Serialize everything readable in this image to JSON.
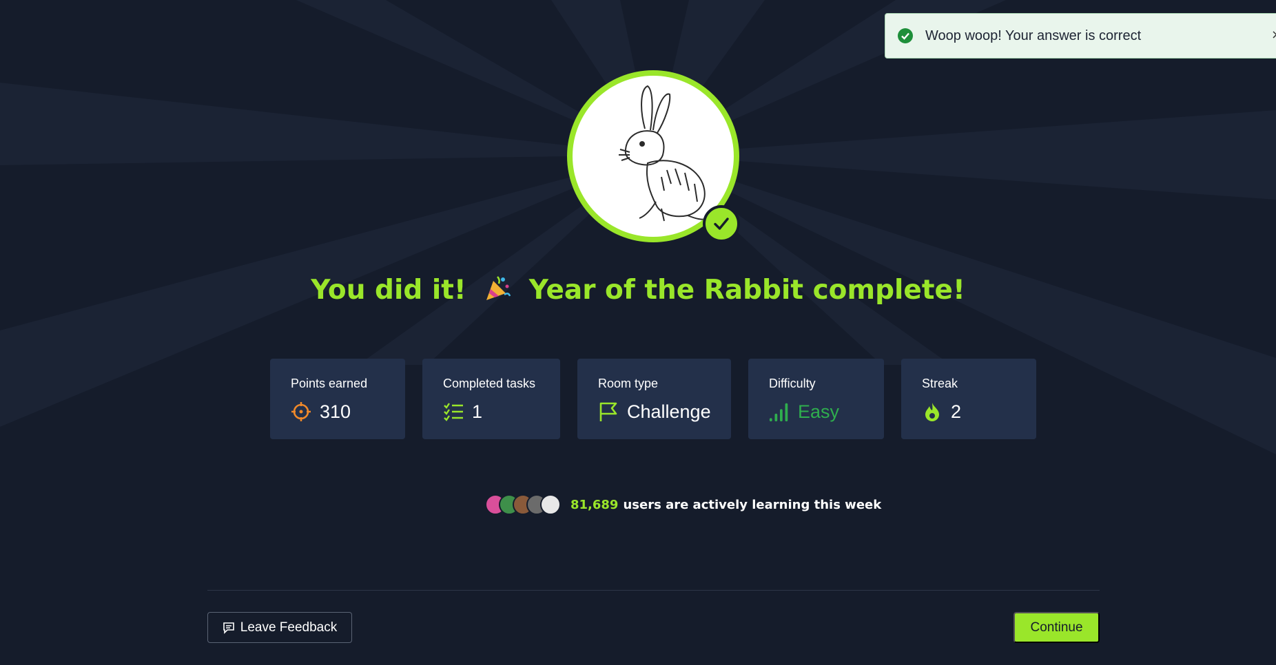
{
  "toast": {
    "message": "Woop woop! Your answer is correct",
    "close": "×",
    "icon": "check-circle-icon"
  },
  "completion": {
    "title_before": "You did it!",
    "title_after": "Year of the Rabbit complete!",
    "avatar": "rabbit-sketch",
    "accent_color": "#9ae62a"
  },
  "stats": [
    {
      "label": "Points earned",
      "value": "310",
      "icon": "target-icon"
    },
    {
      "label": "Completed tasks",
      "value": "1",
      "icon": "checklist-icon"
    },
    {
      "label": "Room type",
      "value": "Challenge",
      "icon": "flag-icon"
    },
    {
      "label": "Difficulty",
      "value": "Easy",
      "icon": "signal-bars-icon"
    },
    {
      "label": "Streak",
      "value": "2",
      "icon": "flame-icon"
    }
  ],
  "users": {
    "count": "81,689",
    "text": "users are actively learning this week"
  },
  "footer": {
    "feedback_label": "Leave Feedback",
    "continue_label": "Continue"
  }
}
